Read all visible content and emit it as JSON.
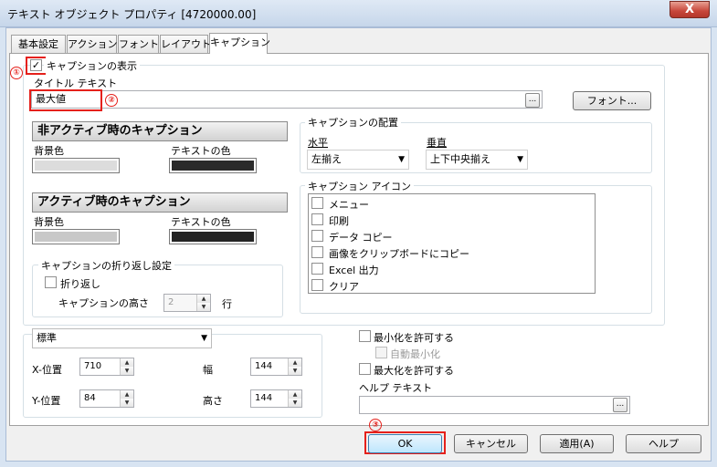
{
  "window": {
    "title": "テキスト オブジェクト プロパティ [4720000.00]",
    "close_glyph": "X"
  },
  "tabs": [
    {
      "label": "基本設定"
    },
    {
      "label": "アクション"
    },
    {
      "label": "フォント"
    },
    {
      "label": "レイアウト"
    },
    {
      "label": "キャプション",
      "active": true
    }
  ],
  "caption": {
    "show_label": "キャプションの表示",
    "show_checked": true,
    "check_glyph": "✓",
    "title_text_label": "タイトル テキスト",
    "title_text_value": "最大値",
    "browse_label": "...",
    "font_button": "フォント..."
  },
  "inactive": {
    "heading": "非アクティブ時のキャプション",
    "bg_label": "背景色",
    "text_label": "テキストの色",
    "bg_color": "#dcdcdc",
    "text_color": "#2a2a2a"
  },
  "active": {
    "heading": "アクティブ時のキャプション",
    "bg_label": "背景色",
    "text_label": "テキストの色",
    "bg_color": "#c8c8c8",
    "text_color": "#232323"
  },
  "wrap": {
    "legend": "キャプションの折り返し設定",
    "wrap_label": "折り返し",
    "height_label": "キャプションの高さ",
    "height_value": "2",
    "unit": "行"
  },
  "placement": {
    "legend": "キャプションの配置",
    "horizontal_label": "水平",
    "horizontal_value": "左揃え",
    "vertical_label": "垂直",
    "vertical_value": "上下中央揃え"
  },
  "caption_icons": {
    "legend": "キャプション アイコン",
    "items": [
      "メニュー",
      "印刷",
      "データ コピー",
      "画像をクリップボードにコピー",
      "Excel 出力",
      "クリア"
    ]
  },
  "position": {
    "style_value": "標準",
    "x_label": "X-位置",
    "x_value": "710",
    "y_label": "Y-位置",
    "y_value": "84",
    "width_label": "幅",
    "width_value": "144",
    "height_label": "高さ",
    "height_value": "144"
  },
  "window_opts": {
    "minimize_label": "最小化を許可する",
    "auto_minimize_label": "自動最小化",
    "maximize_label": "最大化を許可する",
    "help_text_label": "ヘルプ テキスト",
    "help_browse": "..."
  },
  "buttons": {
    "ok": "OK",
    "cancel": "キャンセル",
    "apply": "適用(A)",
    "help": "ヘルプ"
  },
  "annotations": [
    "①",
    "②",
    "③"
  ],
  "glyphs": {
    "dropdown": "▼",
    "spin_up": "▲",
    "spin_down": "▼"
  },
  "colors": {
    "highlight": "#e5201b",
    "title_gradient_top": "#dfe9f5",
    "close_red": "#c7463a"
  }
}
